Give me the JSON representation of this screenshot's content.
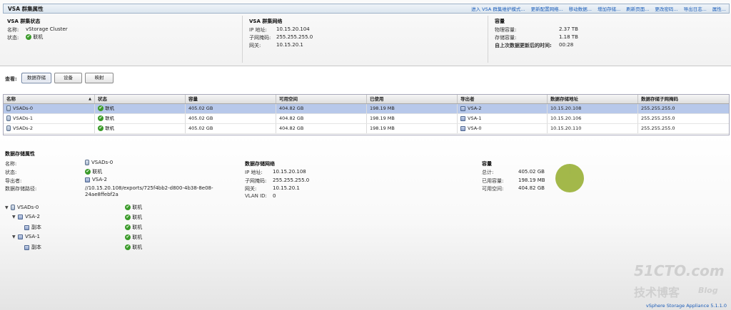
{
  "header": {
    "title": "VSA 群集属性",
    "links": [
      "进入 VSA 群集维护模式...",
      "更新配置网络...",
      "移动数据...",
      "增加存储...",
      "刷新页面...",
      "更改密码...",
      "导出日志...",
      "属性..."
    ]
  },
  "cluster_status": {
    "title": "VSA 群集状态",
    "name_label": "名称:",
    "name_value": "vStorage Cluster",
    "status_label": "状态:",
    "status_value": "联机"
  },
  "cluster_network": {
    "title": "VSA 群集网络",
    "ip_label": "IP 地址:",
    "ip_value": "10.15.20.104",
    "mask_label": "子网掩码:",
    "mask_value": "255.255.255.0",
    "gateway_label": "网关:",
    "gateway_value": "10.15.20.1"
  },
  "capacity_top": {
    "title": "容量",
    "physical_label": "物理容量:",
    "physical_value": "2.37 TB",
    "storage_label": "存储容量:",
    "storage_value": "1.18 TB",
    "updated_label": "自上次数据更新后的时间:",
    "updated_value": "00:28"
  },
  "view": {
    "label": "查看:",
    "buttons": [
      "数据存储",
      "设备",
      "映射"
    ]
  },
  "table": {
    "columns": [
      "名称",
      "状态",
      "容量",
      "可用空间",
      "已使用",
      "导出者",
      "数据存储地址",
      "数据存储子网掩码"
    ],
    "rows": [
      [
        "VSADs-0",
        "联机",
        "405.02 GB",
        "404.82 GB",
        "198.19 MB",
        "VSA-2",
        "10.15.20.108",
        "255.255.255.0"
      ],
      [
        "VSADs-1",
        "联机",
        "405.02 GB",
        "404.82 GB",
        "198.19 MB",
        "VSA-1",
        "10.15.20.106",
        "255.255.255.0"
      ],
      [
        "VSADs-2",
        "联机",
        "405.02 GB",
        "404.82 GB",
        "198.19 MB",
        "VSA-0",
        "10.15.20.110",
        "255.255.255.0"
      ]
    ]
  },
  "ds_props": {
    "title": "数据存储属性",
    "name_label": "名称:",
    "name_value": "VSADs-0",
    "status_label": "状态:",
    "status_value": "联机",
    "exporter_label": "导出者:",
    "exporter_value": "VSA-2",
    "path_label": "数据存储路径:",
    "path_value_1": "//10.15.20.108/exports/725f4bb2-d800-4b38-8e08-",
    "path_value_2": "24ae8ffebf2a"
  },
  "ds_network": {
    "title": "数据存储网络",
    "ip_label": "IP 地址:",
    "ip_value": "10.15.20.108",
    "mask_label": "子网掩码:",
    "mask_value": "255.255.255.0",
    "gateway_label": "网关:",
    "gateway_value": "10.15.20.1",
    "vlan_label": "VLAN ID:",
    "vlan_value": "0"
  },
  "ds_capacity": {
    "title": "容量",
    "total_label": "总计:",
    "total_value": "405.02 GB",
    "used_label": "已用容量:",
    "used_value": "198.19 MB",
    "free_label": "可用空间:",
    "free_value": "404.82 GB",
    "used_fraction": 0.0005,
    "free_color": "#a3b84a"
  },
  "tree": [
    {
      "label": "VSADs-0",
      "status": "联机"
    },
    {
      "label": "VSA-2",
      "status": "联机"
    },
    {
      "label": "副本",
      "status": "联机"
    },
    {
      "label": "VSA-1",
      "status": "联机"
    },
    {
      "label": "副本",
      "status": "联机"
    }
  ],
  "footer": "vSphere Storage Appliance 5.1.1.0",
  "watermark": {
    "line1": "51CTO.com",
    "line2": "技术博客",
    "line3": "Blog"
  }
}
